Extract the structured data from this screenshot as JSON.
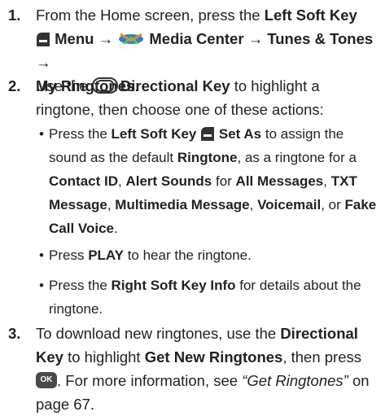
{
  "steps": [
    {
      "number": "1.",
      "parts": {
        "a": "From the Home screen, press the ",
        "b": "Left Soft Key",
        "c": "Menu",
        "arrow1": " → ",
        "d": "Media Center",
        "arrow2": " → ",
        "e": "Tunes & Tones",
        "arrow3": " →",
        "f": "My Ringtones",
        "g": "."
      }
    },
    {
      "number": "2.",
      "parts": {
        "a": "Use the ",
        "b": "Directional Key",
        "c": " to highlight a ringtone, then choose one of these actions:"
      },
      "bullets": [
        {
          "a": "Press the ",
          "b": "Left Soft Key",
          "c": "Set As",
          "d": " to assign the sound as the default ",
          "e": "Ringtone",
          "f": ", as a ringtone for a ",
          "g": "Contact ID",
          "h": ", ",
          "i": "Alert Sounds",
          "j": " for ",
          "k": "All Messages",
          "l": ", ",
          "m": "TXT Message",
          "n": ", ",
          "o": "Multimedia Message",
          "p": ", ",
          "q": "Voicemail",
          "r": ", or ",
          "s": "Fake Call Voice",
          "t": "."
        },
        {
          "a": "Press ",
          "b": "PLAY",
          "c": " to hear the ringtone."
        },
        {
          "a": "Press the ",
          "b": "Right Soft Key Info",
          "c": " for details about the ringtone."
        }
      ]
    },
    {
      "number": "3.",
      "parts": {
        "a": "To download new ringtones, use the ",
        "b": "Directional Key",
        "c": " to highlight ",
        "d": "Get New Ringtones",
        "e": ", then press ",
        "ok": "OK",
        "f": ". For more information, see ",
        "g": "“Get Ringtones”",
        "h": " on page 67."
      }
    }
  ],
  "bullet_glyph": "•",
  "colors": {
    "text": "#222222",
    "softkey": "#333333",
    "media_icon_blue": "#2a7fd4",
    "media_icon_orange": "#f08a1c"
  }
}
